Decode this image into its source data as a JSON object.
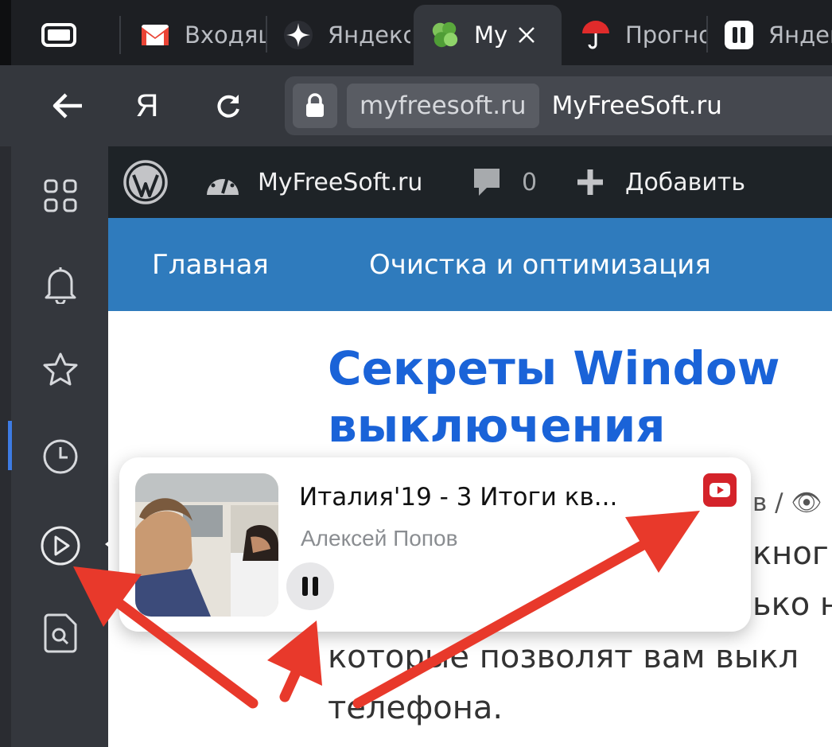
{
  "tabs": [
    {
      "label": "Входящие",
      "icon": "gmail-icon"
    },
    {
      "label": "Яндекс",
      "icon": "alice-star-icon"
    },
    {
      "label": "MyFreeSoft",
      "icon": "myfreesoft-logo-icon",
      "active": true
    },
    {
      "label": "Прогноз",
      "icon": "umbrella-icon"
    },
    {
      "label": "Яндекс",
      "icon": "pause-square-icon"
    }
  ],
  "toolbar": {
    "yandex_label": "Я",
    "address": {
      "domain": "myfreesoft.ru",
      "title": "MyFreeSoft.ru"
    }
  },
  "wp_admin_bar": {
    "site_name": "MyFreeSoft.ru",
    "comments_count": "0",
    "add_label": "Добавить"
  },
  "site_nav": {
    "items": [
      "Главная",
      "Очистка и оптимизация"
    ]
  },
  "article": {
    "title_line1": "Секреты Window",
    "title_line2": "выключения",
    "meta": "в / 👁",
    "lines": [
      "кног",
      "ько н",
      "которые позволят вам выкл",
      "телефона."
    ]
  },
  "media_popup": {
    "track_title": "Италия'19 - 3 Итоги кв...",
    "artist": "Алексей Попов"
  },
  "colors": {
    "accent_blue": "#1a63d8",
    "nav_blue": "#2f7bbd",
    "arrow_red": "#e8392b",
    "youtube_red": "#d4232a"
  }
}
